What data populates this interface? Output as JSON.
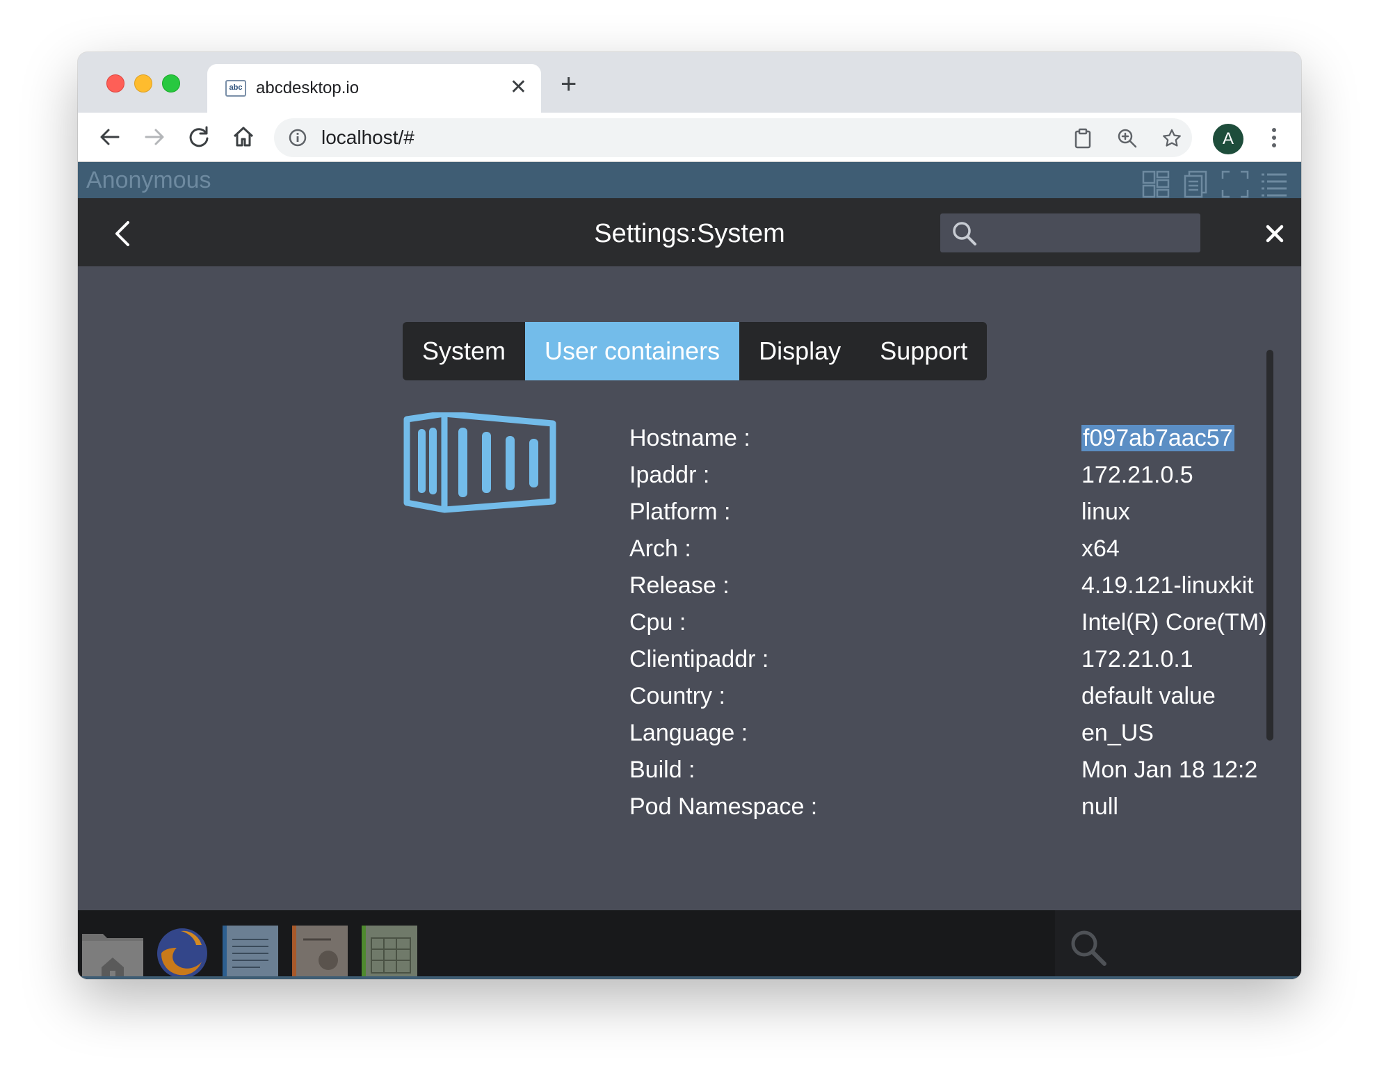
{
  "browser": {
    "tab_title": "abcdesktop.io",
    "tab_favicon_text": "abc",
    "url": "localhost/#",
    "avatar_initial": "A"
  },
  "desktop": {
    "user_name": "Anonymous"
  },
  "settings": {
    "title": "Settings:System",
    "search_value": "",
    "tabs": [
      {
        "label": "System",
        "active": false
      },
      {
        "label": "User containers",
        "active": true
      },
      {
        "label": "Display",
        "active": false
      },
      {
        "label": "Support",
        "active": false
      }
    ],
    "info": [
      {
        "key": "Hostname :",
        "value": "f097ab7aac57"
      },
      {
        "key": "Ipaddr :",
        "value": "172.21.0.5"
      },
      {
        "key": "Platform :",
        "value": "linux"
      },
      {
        "key": "Arch :",
        "value": "x64"
      },
      {
        "key": "Release :",
        "value": "4.19.121-linuxkit"
      },
      {
        "key": "Cpu :",
        "value": "Intel(R) Core(TM)"
      },
      {
        "key": "Clientipaddr :",
        "value": "172.21.0.1"
      },
      {
        "key": "Country :",
        "value": "default value"
      },
      {
        "key": "Language :",
        "value": "en_US"
      },
      {
        "key": "Build :",
        "value": "Mon Jan 18 12:2"
      },
      {
        "key": "Pod Namespace :",
        "value": "null"
      }
    ]
  },
  "colors": {
    "accent": "#73bcea",
    "header_bg": "#2b2c2e",
    "panel_bg": "#4a4d58",
    "userbar_bg": "#3f5d74",
    "selection": "#5b8ec4"
  },
  "dock": {
    "apps": [
      "home-folder-icon",
      "firefox-icon",
      "writer-icon",
      "impress-icon",
      "calc-icon"
    ]
  }
}
